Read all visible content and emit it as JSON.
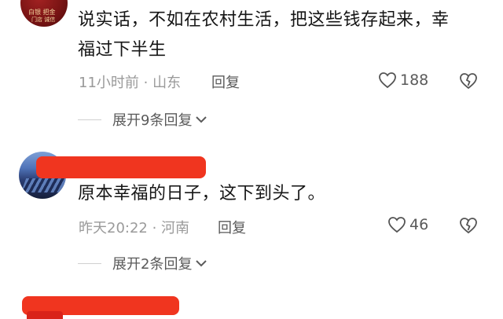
{
  "comments": [
    {
      "avatar_text": [
        "白银 把金",
        "门店 诚信"
      ],
      "text_line1": "说实话，不如在农村生活，把这些钱存起来，幸",
      "text_line2": "福过下半生",
      "time_location": "11小时前 · 山东",
      "reply_label": "回复",
      "like_count": "188",
      "expand_label": "展开9条回复"
    },
    {
      "text_line1": "原本幸福的日子，这下到头了。",
      "time_location": "昨天20:22 · 河南",
      "reply_label": "回复",
      "like_count": "46",
      "expand_label": "展开2条回复"
    }
  ],
  "colors": {
    "redaction": "#f0351f",
    "text": "#161616",
    "meta": "#9a9a9a",
    "secondary": "#5a5a5a"
  },
  "icons": [
    "heart-outline-icon",
    "broken-heart-icon",
    "chevron-down-icon"
  ]
}
